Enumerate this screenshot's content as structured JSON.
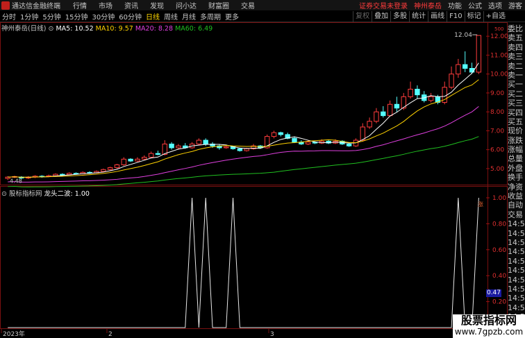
{
  "app": {
    "name": "通达信金融终端"
  },
  "menu": [
    "行情",
    "市场",
    "资讯",
    "发现",
    "问小达",
    "财富圈",
    "交易"
  ],
  "titlebar_right": {
    "warning": "证券交易未登录",
    "stock": "神州泰岳",
    "items": [
      "功能",
      "公式",
      "选项",
      "游客"
    ]
  },
  "periods": [
    "分时",
    "1分钟",
    "5分钟",
    "15分钟",
    "30分钟",
    "60分钟",
    "日线",
    "周线",
    "月线",
    "多周期",
    "更多"
  ],
  "active_period": "日线",
  "right_toolbar": {
    "items": [
      "复权",
      "叠加",
      "多股",
      "统计",
      "画线",
      "F10",
      "标记",
      "+自选"
    ],
    "disabled": [
      "复权"
    ]
  },
  "main_info": {
    "stock_label": "神州泰岳(日线)",
    "ma5": "MA5: 10.52",
    "ma10": "MA10: 9.57",
    "ma20": "MA20: 8.28",
    "ma60": "MA60: 6.49"
  },
  "indicator_info": {
    "source": "股标指标网",
    "formula": "龙头二波: 1.00"
  },
  "price_axis": [
    "12.00",
    "11.00",
    "10.00",
    "9.00",
    "8.00",
    "7.00",
    "6.00",
    "5.00"
  ],
  "high_label": "12.04",
  "low_label": "4.48",
  "ind_axis": [
    "1.00",
    "0.80",
    "0.60",
    "0.40",
    "0.20"
  ],
  "ind_value": "0.47",
  "axis_top_tag": "500",
  "date_labels": [
    "2023年",
    "2",
    "3"
  ],
  "side_panel": [
    "委比",
    "卖五",
    "卖四",
    "卖三",
    "卖二",
    "卖一",
    "买一",
    "买二",
    "买三",
    "买四",
    "买五",
    "现价",
    "涨跌",
    "涨幅",
    "总量",
    "外盘",
    "换手",
    "净资",
    "收益",
    "自动",
    "交易",
    "14:5",
    "14:5",
    "14:5",
    "14:5",
    "14:5",
    "14:5",
    "14:5",
    "14:5",
    "14:5",
    "14:5",
    "14:5",
    "14:5"
  ],
  "chart_markers": {
    "flag": "涨"
  },
  "colors": {
    "up": "#ff3c3c",
    "down": "#54ffff",
    "ma5": "#ffffff",
    "ma10": "#ffd200",
    "ma20": "#e040e0",
    "ma60": "#20c020"
  },
  "watermark": {
    "line1": "股票指标网",
    "line2": "www.7gpzb.com"
  },
  "chart_data": {
    "type": "candlestick",
    "price_range": [
      4.3,
      12.3
    ],
    "candles": [
      [
        4.48,
        4.55,
        4.4,
        4.6
      ],
      [
        4.55,
        4.58,
        4.5,
        4.62
      ],
      [
        4.55,
        4.5,
        4.45,
        4.6
      ],
      [
        4.5,
        4.55,
        4.45,
        4.6
      ],
      [
        4.55,
        4.6,
        4.5,
        4.65
      ],
      [
        4.6,
        4.58,
        4.52,
        4.65
      ],
      [
        4.58,
        4.62,
        4.55,
        4.68
      ],
      [
        4.62,
        4.7,
        4.58,
        4.75
      ],
      [
        4.7,
        4.68,
        4.62,
        4.75
      ],
      [
        4.68,
        4.75,
        4.65,
        4.8
      ],
      [
        4.75,
        4.72,
        4.68,
        4.8
      ],
      [
        4.72,
        4.8,
        4.7,
        4.85
      ],
      [
        4.8,
        4.78,
        4.72,
        4.86
      ],
      [
        4.78,
        4.85,
        4.75,
        4.9
      ],
      [
        4.85,
        4.95,
        4.8,
        5.0
      ],
      [
        4.95,
        5.05,
        4.9,
        5.1
      ],
      [
        5.05,
        5.2,
        5.0,
        5.25
      ],
      [
        5.2,
        5.5,
        5.15,
        5.6
      ],
      [
        5.5,
        5.4,
        5.35,
        5.55
      ],
      [
        5.4,
        5.5,
        5.35,
        5.6
      ],
      [
        5.5,
        5.6,
        5.45,
        5.7
      ],
      [
        5.6,
        5.8,
        5.55,
        5.9
      ],
      [
        5.8,
        5.75,
        5.7,
        5.95
      ],
      [
        5.75,
        6.3,
        5.7,
        6.5
      ],
      [
        6.3,
        6.1,
        6.0,
        6.4
      ],
      [
        6.1,
        6.2,
        6.0,
        6.3
      ],
      [
        6.2,
        6.1,
        6.05,
        6.35
      ],
      [
        6.1,
        6.3,
        6.05,
        6.4
      ],
      [
        6.3,
        6.5,
        6.25,
        6.6
      ],
      [
        6.5,
        6.3,
        6.2,
        6.6
      ],
      [
        6.3,
        6.2,
        6.1,
        6.4
      ],
      [
        6.2,
        6.1,
        6.0,
        6.3
      ],
      [
        6.1,
        6.15,
        6.05,
        6.25
      ],
      [
        6.15,
        6.05,
        6.0,
        6.2
      ],
      [
        6.05,
        5.95,
        5.9,
        6.1
      ],
      [
        5.95,
        6.05,
        5.9,
        6.1
      ],
      [
        6.05,
        6.2,
        6.0,
        6.3
      ],
      [
        6.2,
        6.1,
        6.05,
        6.25
      ],
      [
        6.1,
        6.7,
        6.05,
        6.8
      ],
      [
        6.7,
        6.9,
        6.6,
        7.0
      ],
      [
        6.9,
        6.8,
        6.7,
        6.95
      ],
      [
        6.8,
        6.6,
        6.55,
        6.9
      ],
      [
        6.6,
        6.4,
        6.35,
        6.7
      ],
      [
        6.4,
        6.3,
        6.25,
        6.5
      ],
      [
        6.3,
        6.4,
        6.25,
        6.5
      ],
      [
        6.4,
        6.35,
        6.3,
        6.45
      ],
      [
        6.35,
        6.45,
        6.3,
        6.55
      ],
      [
        6.45,
        6.35,
        6.3,
        6.5
      ],
      [
        6.35,
        6.45,
        6.3,
        6.55
      ],
      [
        6.45,
        6.3,
        6.25,
        6.5
      ],
      [
        6.3,
        6.2,
        6.15,
        6.4
      ],
      [
        6.2,
        6.5,
        6.15,
        6.6
      ],
      [
        6.5,
        7.2,
        6.45,
        7.4
      ],
      [
        7.2,
        7.5,
        7.1,
        7.7
      ],
      [
        7.5,
        8.0,
        7.4,
        8.2
      ],
      [
        8.0,
        7.8,
        7.7,
        8.3
      ],
      [
        7.8,
        8.4,
        7.75,
        8.6
      ],
      [
        8.4,
        8.2,
        8.0,
        8.8
      ],
      [
        8.2,
        8.8,
        8.1,
        9.0
      ],
      [
        8.8,
        9.2,
        8.7,
        9.6
      ],
      [
        9.2,
        8.9,
        8.7,
        9.4
      ],
      [
        8.9,
        8.6,
        8.5,
        9.1
      ],
      [
        8.6,
        8.8,
        8.5,
        9.0
      ],
      [
        8.8,
        8.5,
        8.4,
        8.9
      ],
      [
        8.5,
        9.3,
        8.4,
        9.6
      ],
      [
        9.3,
        10.0,
        9.2,
        10.4
      ],
      [
        10.0,
        10.5,
        9.8,
        10.8
      ],
      [
        10.5,
        10.3,
        10.1,
        11.2
      ],
      [
        10.3,
        10.1,
        10.0,
        10.6
      ],
      [
        10.1,
        12.04,
        10.0,
        12.04
      ]
    ],
    "ma5_start": 4.6,
    "ma5_end": 10.52,
    "ma10_end": 9.57,
    "ma20_end": 8.28,
    "ma60_end": 6.49,
    "indicator": {
      "name": "龙头二波",
      "signal_index": [
        38,
        41,
        47,
        94,
        99
      ],
      "last_value": 1.0,
      "range": [
        0,
        1
      ]
    }
  }
}
